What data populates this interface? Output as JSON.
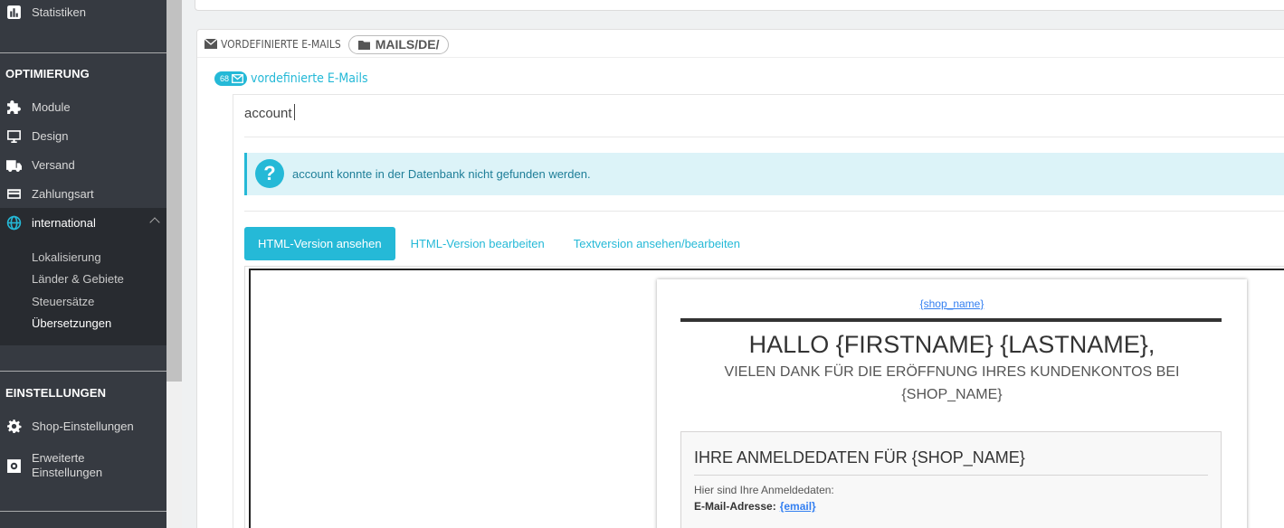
{
  "sidebar": {
    "top_item": {
      "label": "Statistiken",
      "icon": "bar-chart-icon"
    },
    "section_optimierung": "OPTIMIERUNG",
    "items": [
      {
        "label": "Module",
        "icon": "puzzle-icon"
      },
      {
        "label": "Design",
        "icon": "monitor-icon"
      },
      {
        "label": "Versand",
        "icon": "truck-icon"
      },
      {
        "label": "Zahlungsart",
        "icon": "credit-card-icon"
      },
      {
        "label": "international",
        "icon": "globe-icon"
      }
    ],
    "sub_items": [
      "Lokalisierung",
      "Länder & Gebiete",
      "Steuersätze",
      "Übersetzungen"
    ],
    "section_einstellungen": "EINSTELLUNGEN",
    "settings_items": [
      {
        "label": "Shop-Einstellungen",
        "icon": "gear-icon"
      },
      {
        "label_line1": "Erweiterte",
        "label_line2": "Einstellungen",
        "icon": "settings-box-icon"
      }
    ]
  },
  "panel": {
    "title": "VORDEFINIERTE E-MAILS",
    "path": "MAILS/DE/",
    "count": "68",
    "count_label": "vordefinierte E-Mails"
  },
  "search": {
    "value": "account"
  },
  "alert": {
    "message": "account konnte in der Datenbank nicht gefunden werden."
  },
  "tabs": [
    "HTML-Version ansehen",
    "HTML-Version bearbeiten",
    "Textversion ansehen/bearbeiten"
  ],
  "email": {
    "shop_link": "{shop_name}",
    "greeting": "HALLO {FIRSTNAME} {LASTNAME},",
    "thanks": "VIELEN DANK FÜR DIE ERÖFFNUNG IHRES KUNDENKONTOS BEI {SHOP_NAME}",
    "box_title": "IHRE ANMELDEDATEN FÜR {SHOP_NAME}",
    "box_intro": "Hier sind Ihre Anmeldedaten:",
    "email_label": "E-Mail-Adresse:",
    "email_value": "{email}"
  },
  "colors": {
    "accent": "#25b9d7",
    "sidebar": "#363a41",
    "alert_bg": "#dcf3f8"
  }
}
